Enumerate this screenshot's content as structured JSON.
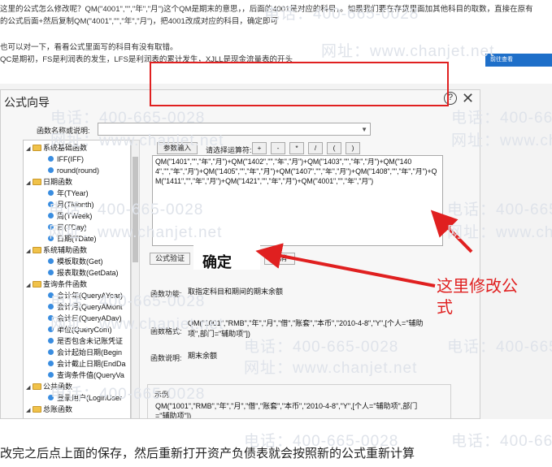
{
  "article": {
    "line1": "这里的公式怎么修改呢？QM(\"4001\",\"\",\"年\",\"月\")这个QM是期末的意思，，后面的4001是对应的科目，。如果我们要在存货里面加其他科目的取数，直接在原有",
    "line2": "的公式后面+然后复制QM(\"4001\",\"\",\"年\",\"月\")，把4001改成对应的科目，确定即可",
    "line3": "也可以对一下，看看公式里面写的科目有没有取错。",
    "line4": "QC是期初，FS是利润表的发生，LFS是利润表的累计发生，XJLL是现金流量表的开头",
    "bottom": "改完之后点上面的保存，然后重新打开资产负债表就会按照新的公式重新计算"
  },
  "ad_label": "前往查看",
  "watermark": {
    "phone": "电话：400-665-0028",
    "site": "网址：www.chanjet.net"
  },
  "dialog": {
    "title": "公式向导",
    "func_search_label": "函数名称或说明:",
    "toolbar": {
      "params_button": "参数输入",
      "operators_label": "请选择运算符:",
      "op_plus": "+",
      "op_minus": "-",
      "op_mul": "*",
      "op_div": "/",
      "op_lparen": "(",
      "op_rparen": ")"
    },
    "formula": "QM(\"1401\",\"\",\"年\",\"月\")+QM(\"1402\",\"\",\"年\",\"月\")+QM(\"1403\",\"\",\"年\",\"月\")+QM(\"1404\",\"\",\"年\",\"月\")+QM(\"1405\",\"\",\"年\",\"月\")+QM(\"1407\",\"\",\"年\",\"月\")+QM(\"1408\",\"\",\"年\",\"月\")+QM(\"1411\",\"\",\"年\",\"月\")+QM(\"1421\",\"\",\"年\",\"月\")+QM(\"4001\",\"\",\"年\",\"月\")",
    "verify_button": "公式验证",
    "ok_button": "确定",
    "cancel_button": "取消",
    "func_desc_label": "函数功能:",
    "func_desc_value": "取指定科目和期间的期末余额",
    "func_format_label": "函数格式:",
    "func_format_value_1": "QM(\"1001\",\"RMB\",\"年\",\"月\",\"借\",\"账套\",\"本币\",\"2010-4-8\",\"Y\",[个人=\"辅助",
    "func_format_value_2": "项\",部门=\"辅助项\"])",
    "func_note_label": "函数说明:",
    "func_note_value": "期末余额",
    "example_label": "示例",
    "example_value_1": "QM(\"1001\",\"RMB\",\"年\",\"月\",\"借\",\"账套\",\"本币\",\"2010-4-8\",\"Y\",[个人=\"辅助项\",部门",
    "example_value_2": "=\"辅助项\"])"
  },
  "tree": [
    {
      "label": "系统基础函数",
      "kind": "folder"
    },
    {
      "label": "IFF(IFF)",
      "kind": "func"
    },
    {
      "label": "round(round)",
      "kind": "func"
    },
    {
      "label": "日期函数",
      "kind": "folder"
    },
    {
      "label": "年(TYear)",
      "kind": "func"
    },
    {
      "label": "月(TMonth)",
      "kind": "func"
    },
    {
      "label": "周(TWeek)",
      "kind": "func"
    },
    {
      "label": "日(TDay)",
      "kind": "func"
    },
    {
      "label": "日期(TDate)",
      "kind": "func"
    },
    {
      "label": "系统辅助函数",
      "kind": "folder"
    },
    {
      "label": "模板取数(Get)",
      "kind": "func"
    },
    {
      "label": "报表取数(GetData)",
      "kind": "func"
    },
    {
      "label": "查询条件函数",
      "kind": "folder"
    },
    {
      "label": "会计年(QueryAYear)",
      "kind": "func"
    },
    {
      "label": "会计月(QueryAMont",
      "kind": "func"
    },
    {
      "label": "会计日(QueryADay)",
      "kind": "func"
    },
    {
      "label": "单位(QueryCom)",
      "kind": "func"
    },
    {
      "label": "是否包含未记账凭证",
      "kind": "func"
    },
    {
      "label": "会计起始日期(Begin",
      "kind": "func"
    },
    {
      "label": "会计截止日期(EndDa",
      "kind": "func"
    },
    {
      "label": "查询条件值(QueryVa",
      "kind": "func"
    },
    {
      "label": "公共函数",
      "kind": "folder"
    },
    {
      "label": "登录用户(LoginUser",
      "kind": "func"
    },
    {
      "label": "总账函数",
      "kind": "folder"
    }
  ],
  "annotation": "这里修改公式",
  "colors": {
    "annotation_red": "#e02020",
    "folder_yellow": "#f0c24a",
    "func_blue": "#3a8de0"
  }
}
